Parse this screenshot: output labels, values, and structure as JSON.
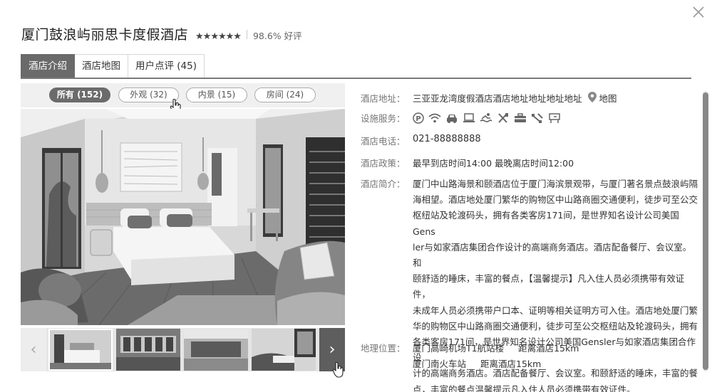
{
  "hotel": {
    "name": "厦门鼓浪屿丽思卡度假酒店",
    "stars": "★★★★★★",
    "rating": "98.6% 好评"
  },
  "tabs": [
    {
      "label": "酒店介绍"
    },
    {
      "label": "酒店地图"
    },
    {
      "label": "用户点评 (45)"
    }
  ],
  "filters": [
    {
      "label": "所有 (152)"
    },
    {
      "label": "外观 (32)"
    },
    {
      "label": "内景 (15)"
    },
    {
      "label": "房间 (24)"
    }
  ],
  "info": {
    "address_label": "酒店地址：",
    "address": "三亚亚龙湾度假酒店酒店地址地址地址地址",
    "map_link": "地图",
    "facilities_label": "设施服务：",
    "facility_icons": [
      "parking-icon",
      "wifi-icon",
      "car-icon",
      "desk-icon",
      "pool-icon",
      "restaurant-icon",
      "business-icon",
      "gym-icon",
      "meeting-icon"
    ],
    "phone_label": "酒店电话：",
    "phone": "021-88888888",
    "policy_label": "酒店政策：",
    "policy": "最早到店时间14:00 最晚离店时间12:00",
    "intro_label": "酒店简介：",
    "intro_lines": [
      "厦门中山路海景和颐酒店位于厦门海滨景观带，与厦门著名景点鼓浪屿隔",
      "海相望。酒店地处厦门繁华的购物区中山路商圈交通便利，徒步可至公交",
      "枢纽站及轮渡码头，拥有各类客房171间，是世界知名设计公司美国Gens",
      "ler与如家酒店集团合作设计的高端商务酒店。酒店配备餐厅、会议室。和",
      "颐舒适的睡床，丰富的餐点，【温馨提示】凡入住人员必须携带有效证件，",
      "未成年人员必须携带户口本、证明等相关证明方可入住。酒店地处厦门繁",
      "华的购物区中山路商圈交通便利，徒步可至公交枢纽站及轮渡码头，拥有",
      "各类客房171间，是世界知名设计公司美国Gensler与如家酒店集团合作设",
      "计的高端商务酒店。酒店配备餐厅、会议室。和颐舒适的睡床，丰富的餐",
      "点，丰富的餐点温馨提示凡入住人员必须携带有效证件。"
    ],
    "location_label": "地理位置：",
    "locations": [
      {
        "place": "厦门高崎机场T1航站楼",
        "distance": "距离酒店15km"
      },
      {
        "place": "厦门南火车站",
        "distance": "距离酒店15km"
      }
    ]
  },
  "gallery": {
    "prev_icon": "‹",
    "next_icon": "›"
  }
}
